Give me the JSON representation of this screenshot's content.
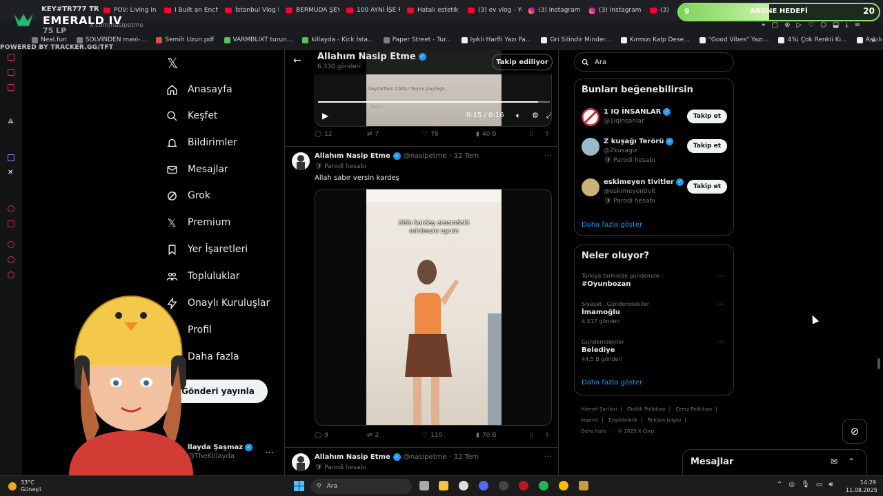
{
  "browser": {
    "tabs": [
      {
        "label": "POV: Living in a",
        "icon": "youtube-icon"
      },
      {
        "label": "I Built an Encha",
        "icon": "youtube-icon"
      },
      {
        "label": "İstanbul Vlog P",
        "icon": "youtube-icon"
      },
      {
        "label": "BERMUDA ŞEY",
        "icon": "youtube-icon"
      },
      {
        "label": "100 AYNI İŞE F",
        "icon": "youtube-icon"
      },
      {
        "label": "Hatalı estetik o",
        "icon": "youtube-icon"
      },
      {
        "label": "(3) ev vlog - Yo",
        "icon": "youtube-icon"
      },
      {
        "label": "(3) Instagram",
        "icon": "instagram-icon"
      },
      {
        "label": "(3) Instagram",
        "icon": "instagram-icon"
      },
      {
        "label": "(3)",
        "icon": "youtube-icon"
      }
    ],
    "url": "x.com/nasipetme",
    "bookmarks": [
      "Neal.fun",
      "SOLVINDEN mavi-...",
      "Semih Uzun.pdf",
      "VARMBLIXT turun...",
      "killayda - Kick İsta...",
      "Paper Street - Tur...",
      "Işıklı Harfli Yazı Pa...",
      "Gri Silindir Minder...",
      "Kırmızı Kalp Dese...",
      "\"Good Vibes\" Yazı...",
      "4'lü Çok Renkli Kı...",
      "Askılı Metal Sepet..."
    ]
  },
  "overlay": {
    "key_text": "KEY#TR777 TR",
    "rank": "EMERALD IV",
    "lp": "75 LP",
    "powered": "POWERED BY TRACKER.GG/TFT",
    "goal_left": "9",
    "goal_label": "ABONE HEDEFİ",
    "goal_right": "20",
    "goal_progress": 0.45
  },
  "nav": {
    "items": [
      {
        "label": "Anasayfa",
        "icon": "home-icon"
      },
      {
        "label": "Keşfet",
        "icon": "search-icon"
      },
      {
        "label": "Bildirimler",
        "icon": "bell-icon"
      },
      {
        "label": "Mesajlar",
        "icon": "mail-icon"
      },
      {
        "label": "Grok",
        "icon": "grok-icon"
      },
      {
        "label": "Premium",
        "icon": "x-premium-icon"
      },
      {
        "label": "Yer İşaretleri",
        "icon": "bookmark-icon"
      },
      {
        "label": "Topluluklar",
        "icon": "people-icon"
      },
      {
        "label": "Onaylı Kuruluşlar",
        "icon": "lightning-icon"
      },
      {
        "label": "Profil",
        "icon": "person-icon"
      },
      {
        "label": "Daha fazla",
        "icon": "more-circle-icon"
      }
    ],
    "post_label": "Gönderi yayınla",
    "account_name": "llayda Şaşmaz",
    "account_handle": "@TheKillayda"
  },
  "timeline": {
    "title": "Allahım Nasip Etme",
    "subtitle": "6.330 gönderi",
    "follow_label": "Takip ediliyor",
    "video_chat_line": "IlaydaTass CANLI Yayını paylaştı",
    "video_input_placeholder": "Yazın...",
    "video_time": "0:15 / 0:16",
    "video_progress": 0.95,
    "post1_actions": {
      "replies": "12",
      "reposts": "7",
      "likes": "78",
      "views": "40 B"
    },
    "post2": {
      "name": "Allahım Nasip Etme",
      "handle": "@nasipetme",
      "date": "· 12 Tem",
      "parody": "Parodi hesabı",
      "text": "Allah sabır versin kardeş",
      "caption": "Abla kardeş arasındaki\nminimum uyum",
      "actions": {
        "replies": "9",
        "reposts": "2",
        "likes": "110",
        "views": "70 B"
      }
    },
    "post3": {
      "name": "Allahım Nasip Etme",
      "handle": "@nasipetme",
      "date": "· 12 Tem",
      "parody": "Parodi hesabı"
    }
  },
  "right": {
    "search_placeholder": "Ara",
    "who_title": "Bunları beğenebilirsin",
    "who": [
      {
        "name": "1 IQ İNSANLAR",
        "handle": "@1iqinsanlar",
        "parody": ""
      },
      {
        "name": "Z kuşağı Terörü",
        "handle": "@Zkusagiz",
        "parody": "Parodi hesabı"
      },
      {
        "name": "eskimeyen tivitler",
        "handle": "@eskimeyentivit",
        "parody": "Parodi hesabı"
      }
    ],
    "follow_label": "Takip et",
    "show_more": "Daha fazla göster",
    "trends_title": "Neler oluyor?",
    "trends": [
      {
        "context": "Türkiye tarihinde gündemde",
        "title": "#Oyunbozan",
        "count": ""
      },
      {
        "context": "Siyaset · Gündemdekiler",
        "title": "İmamoğlu",
        "count": "4.517 gönderi"
      },
      {
        "context": "Gündemdekiler",
        "title": "Belediye",
        "count": "44,5 B gönderi"
      }
    ],
    "trends_more": "Daha fazla göster",
    "footer": [
      "Hizmet Şartları",
      "|",
      "Gizlilik Politikası",
      "|",
      "Çerez Politikası",
      "|",
      "Imprint",
      "|",
      "Erişilebilirlik",
      "|",
      "Reklam bilgisi",
      "|",
      "Daha fazla ···",
      "© 2025 X Corp."
    ]
  },
  "messages": {
    "title": "Mesajlar"
  },
  "taskbar": {
    "temp": "33°C",
    "weather": "Güneşli",
    "search": "Ara",
    "time": "14:29",
    "date": "11.08.2025"
  },
  "colors": {
    "accent": "#1d9bf0",
    "background": "#000000",
    "goal_green": "#8fe36b"
  }
}
